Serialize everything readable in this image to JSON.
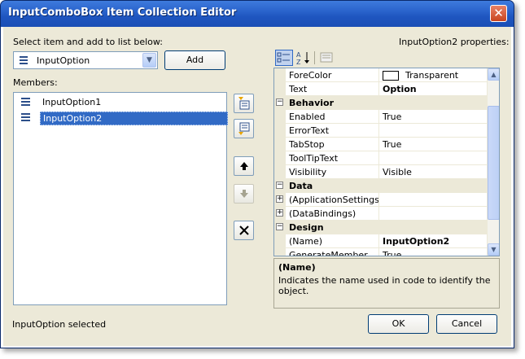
{
  "window": {
    "title": "InputComboBox Item Collection Editor",
    "close_glyph": "✕"
  },
  "left": {
    "select_label": "Select item and add to list below:",
    "type_combo_value": "InputOption",
    "add_button": "Add",
    "members_label": "Members:",
    "members": [
      {
        "label": "InputOption1",
        "selected": false
      },
      {
        "label": "InputOption2",
        "selected": true
      }
    ],
    "status": "InputOption selected"
  },
  "right": {
    "properties_label": "InputOption2 properties:",
    "grid": {
      "rows": [
        {
          "type": "prop",
          "name": "ForeColor",
          "value": "Transparent",
          "swatch": true
        },
        {
          "type": "prop",
          "name": "Text",
          "value": "Option",
          "bold": true
        },
        {
          "type": "cat",
          "name": "Behavior",
          "expander": "−"
        },
        {
          "type": "prop",
          "name": "Enabled",
          "value": "True"
        },
        {
          "type": "prop",
          "name": "ErrorText",
          "value": ""
        },
        {
          "type": "prop",
          "name": "TabStop",
          "value": "True"
        },
        {
          "type": "prop",
          "name": "ToolTipText",
          "value": ""
        },
        {
          "type": "prop",
          "name": "Visibility",
          "value": "Visible"
        },
        {
          "type": "cat",
          "name": "Data",
          "expander": "−"
        },
        {
          "type": "expandable",
          "name": "(ApplicationSettings)",
          "value": "",
          "expander": "+"
        },
        {
          "type": "expandable",
          "name": "(DataBindings)",
          "value": "",
          "expander": "+"
        },
        {
          "type": "cat",
          "name": "Design",
          "expander": "−"
        },
        {
          "type": "prop",
          "name": "(Name)",
          "value": "InputOption2",
          "bold": true
        },
        {
          "type": "prop",
          "name": "GenerateMember",
          "value": "True"
        }
      ]
    },
    "help_title": "(Name)",
    "help_text": "Indicates the name used in code to identify the object."
  },
  "buttons": {
    "ok": "OK",
    "cancel": "Cancel"
  },
  "colors": {
    "title_bar": "#2a63cc",
    "dialog_bg": "#ece9d8",
    "selection": "#316ac5"
  }
}
